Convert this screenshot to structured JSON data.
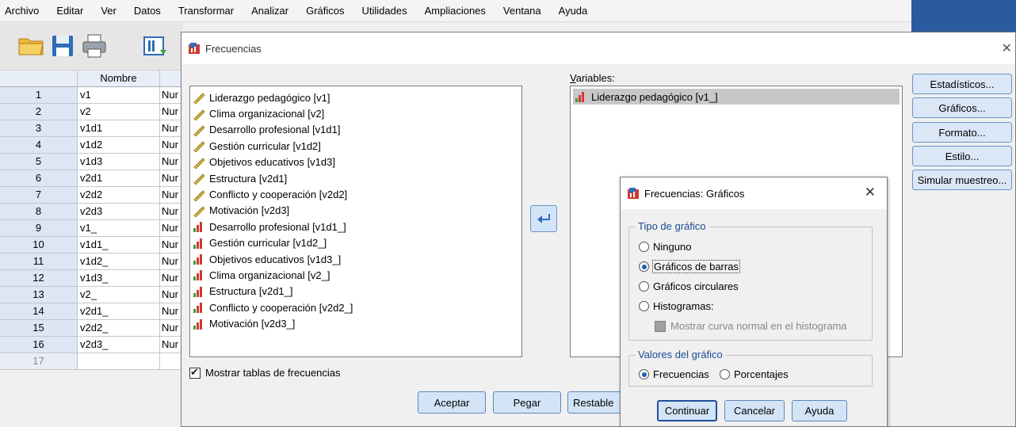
{
  "menubar": {
    "items": [
      "Archivo",
      "Editar",
      "Ver",
      "Datos",
      "Transformar",
      "Analizar",
      "Gráficos",
      "Utilidades",
      "Ampliaciones",
      "Ventana",
      "Ayuda"
    ]
  },
  "grid": {
    "header_name": "Nombre",
    "rows": [
      {
        "num": "1",
        "name": "v1",
        "type": "Nur"
      },
      {
        "num": "2",
        "name": "v2",
        "type": "Nur"
      },
      {
        "num": "3",
        "name": "v1d1",
        "type": "Nur"
      },
      {
        "num": "4",
        "name": "v1d2",
        "type": "Nur"
      },
      {
        "num": "5",
        "name": "v1d3",
        "type": "Nur"
      },
      {
        "num": "6",
        "name": "v2d1",
        "type": "Nur"
      },
      {
        "num": "7",
        "name": "v2d2",
        "type": "Nur"
      },
      {
        "num": "8",
        "name": "v2d3",
        "type": "Nur"
      },
      {
        "num": "9",
        "name": "v1_",
        "type": "Nur"
      },
      {
        "num": "10",
        "name": "v1d1_",
        "type": "Nur"
      },
      {
        "num": "11",
        "name": "v1d2_",
        "type": "Nur"
      },
      {
        "num": "12",
        "name": "v1d3_",
        "type": "Nur"
      },
      {
        "num": "13",
        "name": "v2_",
        "type": "Nur"
      },
      {
        "num": "14",
        "name": "v2d1_",
        "type": "Nur"
      },
      {
        "num": "15",
        "name": "v2d2_",
        "type": "Nur"
      },
      {
        "num": "16",
        "name": "v2d3_",
        "type": "Nur"
      },
      {
        "num": "17",
        "name": "",
        "type": ""
      }
    ]
  },
  "dialog": {
    "title": "Frecuencias",
    "source_list": [
      {
        "label": "Liderazgo pedagógico [v1]",
        "icon": "ruler-icon"
      },
      {
        "label": "Clima organizacional [v2]",
        "icon": "ruler-icon"
      },
      {
        "label": "Desarrollo profesional [v1d1]",
        "icon": "ruler-icon"
      },
      {
        "label": "Gestión curricular [v1d2]",
        "icon": "ruler-icon"
      },
      {
        "label": "Objetivos educativos [v1d3]",
        "icon": "ruler-icon"
      },
      {
        "label": "Estructura [v2d1]",
        "icon": "ruler-icon"
      },
      {
        "label": "Conflicto y cooperación [v2d2]",
        "icon": "ruler-icon"
      },
      {
        "label": "Motivación [v2d3]",
        "icon": "ruler-icon"
      },
      {
        "label": "Desarrollo profesional [v1d1_]",
        "icon": "ordinal-bars-icon"
      },
      {
        "label": "Gestión curricular [v1d2_]",
        "icon": "ordinal-bars-icon"
      },
      {
        "label": "Objetivos educativos [v1d3_]",
        "icon": "ordinal-bars-icon"
      },
      {
        "label": "Clima organizacional [v2_]",
        "icon": "ordinal-bars-icon"
      },
      {
        "label": "Estructura [v2d1_]",
        "icon": "ordinal-bars-icon"
      },
      {
        "label": "Conflicto y cooperación [v2d2_]",
        "icon": "ordinal-bars-icon"
      },
      {
        "label": "Motivación [v2d3_]",
        "icon": "ordinal-bars-icon"
      }
    ],
    "variables_label": "Variables:",
    "selected_variable": "Liderazgo pedagógico [v1_]",
    "show_tables_label": "Mostrar tablas de frecuencias",
    "buttons": {
      "aceptar": "Aceptar",
      "pegar": "Pegar",
      "restablecer": "Restable"
    },
    "side_buttons": {
      "estadisticos": "Estadísticos...",
      "graficos": "Gráficos...",
      "formato": "Formato...",
      "estilo": "Estilo...",
      "simular": "Simular muestreo..."
    }
  },
  "subdialog": {
    "title": "Frecuencias: Gráficos",
    "chart_type_legend": "Tipo de gráfico",
    "options": {
      "ninguno": "Ninguno",
      "barras": "Gráficos de barras",
      "circulares": "Gráficos circulares",
      "histogramas": "Histogramas:"
    },
    "normal_curve": "Mostrar curva normal en el histograma",
    "values_legend": "Valores del gráfico",
    "frecuencias": "Frecuencias",
    "porcentajes": "Porcentajes",
    "buttons": {
      "continuar": "Continuar",
      "cancelar": "Cancelar",
      "ayuda": "Ayuda"
    }
  },
  "colors": {
    "accent": "#1b5fb8",
    "button_bg": "#d4e4f7",
    "title_bar_right": "#2a5b9e"
  }
}
